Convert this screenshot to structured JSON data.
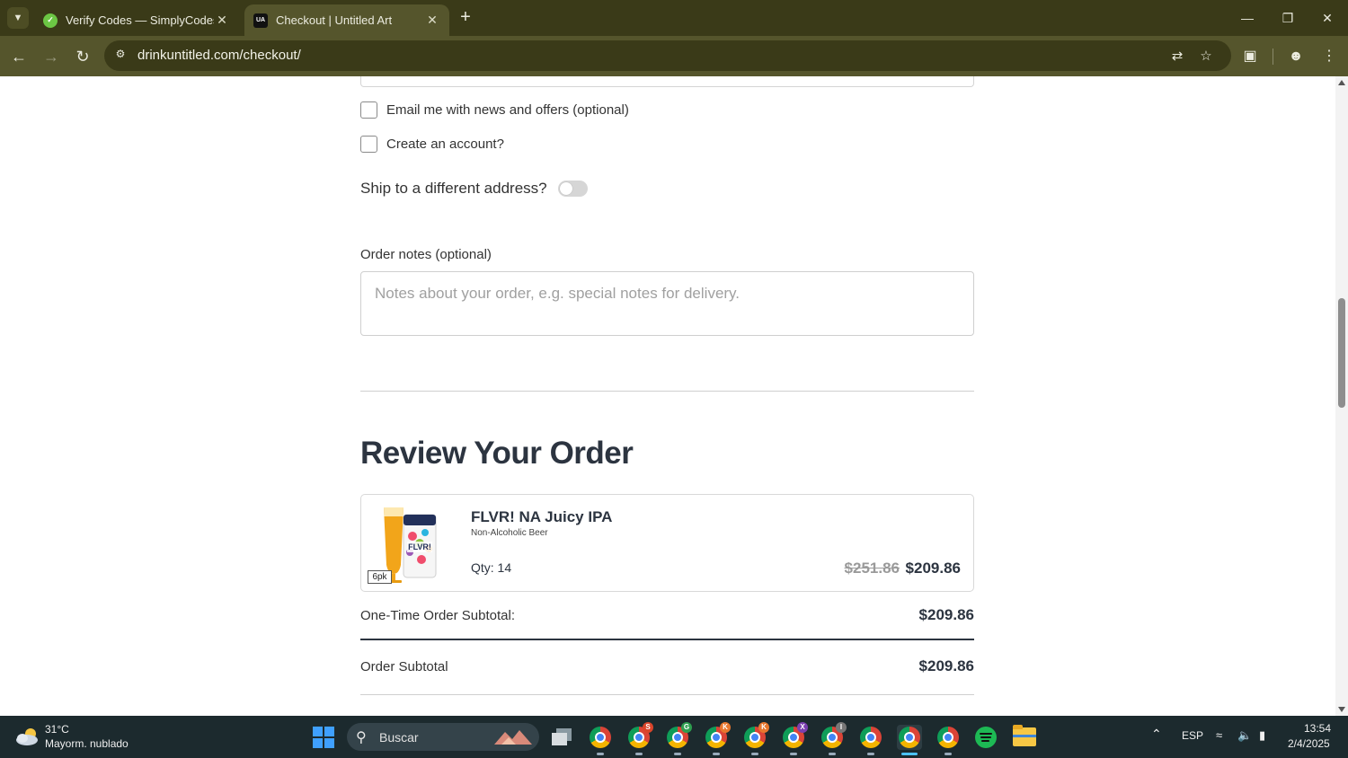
{
  "browser": {
    "tabs": [
      {
        "title": "Verify Codes — SimplyCodes",
        "favicon": "simplycodes-icon",
        "active": false
      },
      {
        "title": "Checkout | Untitled Art",
        "favicon": "UA",
        "active": true
      }
    ],
    "url": "drinkuntitled.com/checkout/"
  },
  "checkout": {
    "email_optin_label": "Email me with news and offers (optional)",
    "create_account_label": "Create an account?",
    "ship_different_label": "Ship to a different address?",
    "ship_different_enabled": false,
    "order_notes_label": "Order notes (optional)",
    "order_notes_placeholder": "Notes about your order, e.g. special notes for delivery.",
    "order_notes_value": ""
  },
  "review": {
    "title": "Review Your Order",
    "item": {
      "name": "FLVR! NA Juicy IPA",
      "category": "Non-Alcoholic Beer",
      "pack": "6pk",
      "qty_text": "Qty: 14",
      "price_original": "$251.86",
      "price_final": "$209.86"
    },
    "one_time_subtotal_label": "One-Time Order Subtotal:",
    "one_time_subtotal_value": "$209.86",
    "order_subtotal_label": "Order Subtotal",
    "order_subtotal_value": "$209.86"
  },
  "taskbar": {
    "weather_temp": "31°C",
    "weather_desc": "Mayorm. nublado",
    "search_placeholder": "Buscar",
    "language": "ESP",
    "time": "13:54",
    "date": "2/4/2025",
    "chrome_badges": [
      "",
      "S",
      "G",
      "K",
      "K",
      "X",
      "I",
      "",
      "",
      ""
    ]
  },
  "colors": {
    "chrome_dark": "#3a3a18",
    "chrome_toolbar": "#55552c",
    "heading_text": "#2c3440",
    "taskbar_bg": "#1c2a2e"
  }
}
